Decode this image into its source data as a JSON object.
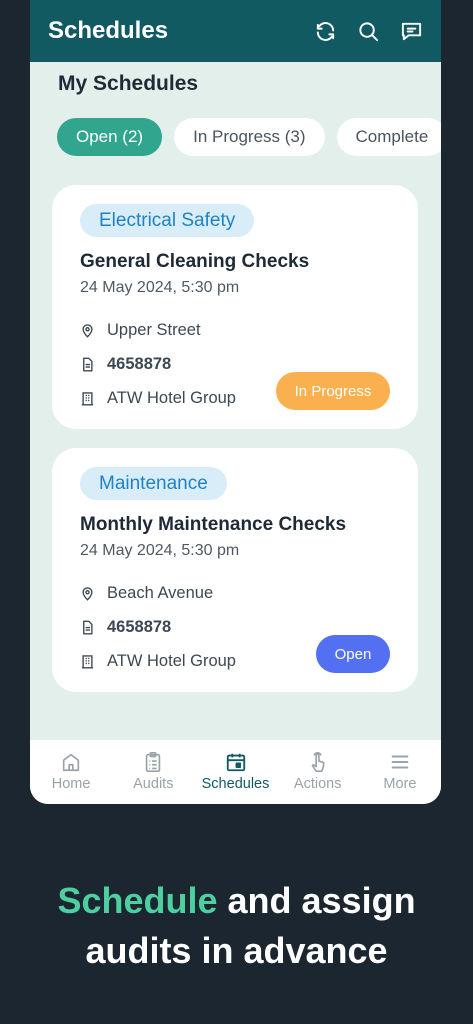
{
  "header": {
    "title": "Schedules",
    "icons": [
      "refresh-icon",
      "search-icon",
      "chat-icon"
    ]
  },
  "section": {
    "title": "My Schedules"
  },
  "filters": [
    {
      "label": "Open (2)",
      "active": true
    },
    {
      "label": "In Progress (3)",
      "active": false
    },
    {
      "label": "Complete",
      "active": false
    }
  ],
  "cards": [
    {
      "tag": "Electrical Safety",
      "title": "General Cleaning Checks",
      "date": "24 May 2024, 5:30 pm",
      "location": "Upper Street",
      "id": "4658878",
      "company": "ATW Hotel Group",
      "status": "In Progress",
      "status_color": "#fbb04f"
    },
    {
      "tag": "Maintenance",
      "title": "Monthly Maintenance Checks",
      "date": "24 May 2024, 5:30 pm",
      "location": "Beach Avenue",
      "id": "4658878",
      "company": "ATW Hotel Group",
      "status": "Open",
      "status_color": "#5470f2"
    }
  ],
  "nav": [
    {
      "label": "Home",
      "icon": "home-icon",
      "active": false
    },
    {
      "label": "Audits",
      "icon": "clipboard-icon",
      "active": false
    },
    {
      "label": "Schedules",
      "icon": "calendar-icon",
      "active": true
    },
    {
      "label": "Actions",
      "icon": "hand-pointer-icon",
      "active": false
    },
    {
      "label": "More",
      "icon": "menu-icon",
      "active": false
    }
  ],
  "tagline": {
    "accent": "Schedule",
    "rest1": " and assign",
    "line2": "audits in advance"
  },
  "colors": {
    "header": "#125a62",
    "accent": "#32a58f",
    "background": "#1c2630",
    "tagline_accent": "#4dcf9f"
  }
}
